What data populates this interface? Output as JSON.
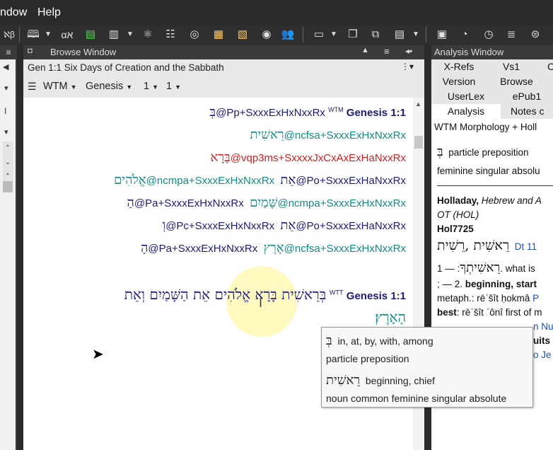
{
  "menubar": {
    "window": "ndow",
    "help": "Help"
  },
  "toolbar": {
    "glyph_alpha": "α",
    "glyph_aleph": "א"
  },
  "browse": {
    "title": "Browse Window",
    "reference": "Gen 1:1 Six Days of Creation and the Sabbath",
    "version": "WTM",
    "book": "Genesis",
    "chapter": "1",
    "verse": "1",
    "lines": [
      {
        "heb": "בְּ",
        "code": "@Pp+SxxxExHxNxxRx",
        "color": "navy"
      },
      {
        "heb": "רֵאשִׁית",
        "code": "@ncfsa+SxxxExHxNxxRx",
        "color": "teal"
      },
      {
        "heb": "בָּרָא",
        "code": "@vqp3ms+SxxxxJxCxAxExHaNxxRx",
        "color": "red"
      },
      {
        "heb": "אֱלֹהִים",
        "code": "@ncmpa+SxxxExHxNxxRx",
        "color": "teal"
      },
      {
        "heb": "אֵת",
        "code": "@Po+SxxxExHaNxxRx",
        "color": "navy"
      },
      {
        "heb": "הַ",
        "code": "@Pa+SxxxExHxNxxRx",
        "color": "navy"
      },
      {
        "heb": "שָּׁמַיִם",
        "code": "@ncmpa+SxxxExHxNxxRx",
        "color": "teal"
      },
      {
        "heb": "וְ",
        "code": "@Pc+SxxxExHxNxxRx",
        "color": "navy"
      },
      {
        "heb": "אֵת",
        "code": "@Po+SxxxExHaNxxRx",
        "color": "navy"
      },
      {
        "heb": "הָ",
        "code": "@Pa+SxxxExHxNxxRx",
        "color": "navy"
      },
      {
        "heb": "אָרֶץ",
        "code": "@ncfsa+SxxxExHxNxxRx",
        "color": "teal"
      }
    ],
    "wtm_label": "WTM",
    "ref1": "Genesis 1:1",
    "wtt_label": "WTT",
    "ref2": "Genesis 1:1",
    "wtt_text": "בְּרֵאשִׁית בָּרָא אֱלֹהִים אֵת הַשָּׁמַיִם וְאֵת",
    "wtt_text2": "הָאָרֶץ׃"
  },
  "analysis": {
    "title": "Analysis Window",
    "tabs": [
      "X-Refs",
      "Vs1",
      "C",
      "Version",
      "Browse",
      "UserLex",
      "ePub1",
      "Analysis",
      "Notes c"
    ],
    "header": "WTM Morphology + Holl",
    "entry1_heb": "בְּ",
    "entry1_pos": "particle preposition",
    "entry1_morph": "feminine singular absolu",
    "lex_title_bold": "Holladay,",
    "lex_title_ital": "Hebrew and A",
    "lex_title_ital2": "OT (HOL)",
    "lex_id": "Hol7725",
    "lex_heb": "רֵאשִׁית ,רֵשִׁית",
    "lex_ref": "Dt 11",
    "lex_line1_heb": "רֵאשִׁיתְךָ",
    "lex_line1": ": — 1. what is",
    "lex_line2": "; — 2.",
    "lex_line2b": "beginning, start",
    "lex_line3": "metaph.: rēʾšît ḥokmâ",
    "lex_line3b": "P",
    "lex_line4b": "best",
    "lex_line4": ": rēʾšît ʾônî first of m",
    "lex_line5": "n Nu",
    "lex_line6": "uits",
    "lex_line7": "o Je"
  },
  "tooltip": {
    "w1_heb": "בְּ",
    "w1_gloss": "in, at, by, with, among",
    "w1_pos": "particle preposition",
    "w2_heb": "רֵאשִׁית",
    "w2_gloss": "beginning, chief",
    "w2_pos": "noun common feminine singular absolute"
  },
  "colors": {
    "teal": "#138a86",
    "red": "#d02020",
    "navy": "#1b1b7a"
  }
}
